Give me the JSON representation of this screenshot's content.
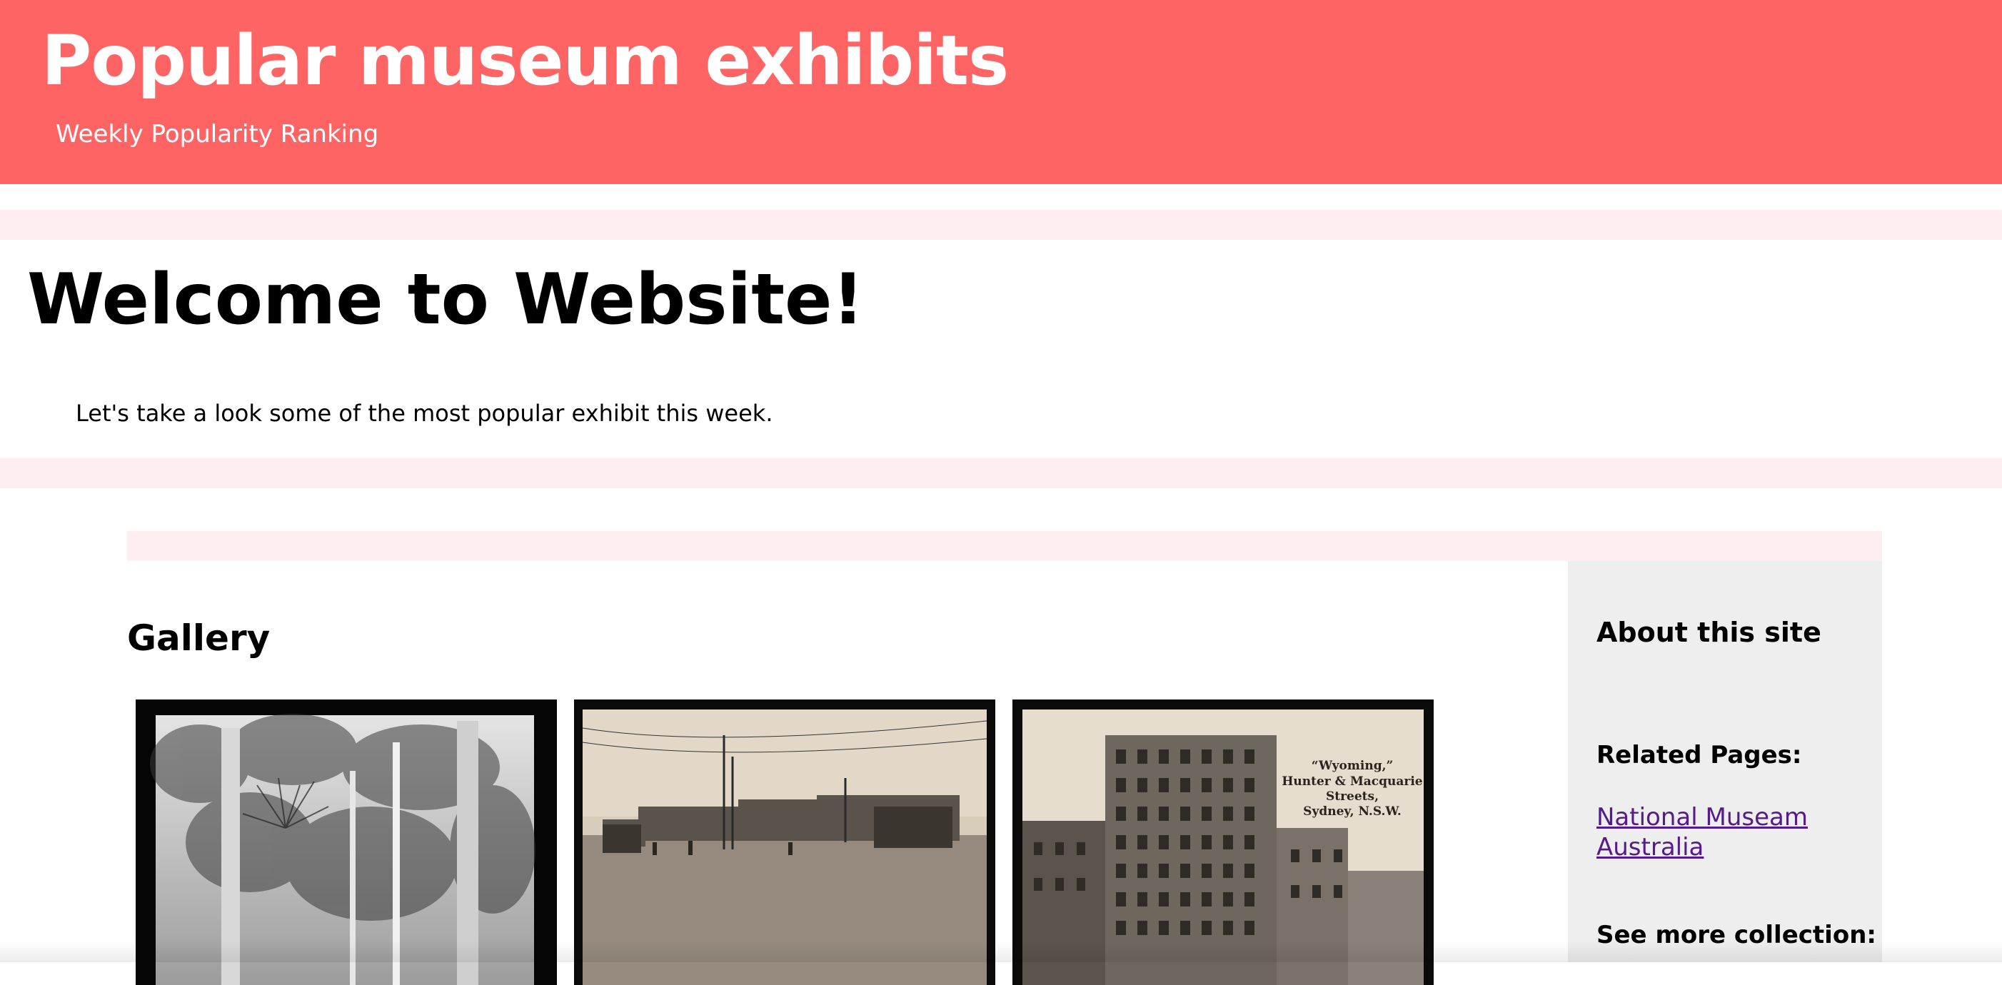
{
  "header": {
    "title": "Popular museum exhibits",
    "subtitle": "Weekly Popularity Ranking",
    "background_color": "#ff6464"
  },
  "welcome": {
    "heading": "Welcome to Website!",
    "text": "Let's take a look some of the most popular exhibit this week."
  },
  "gallery": {
    "heading": "Gallery",
    "items": [
      {
        "image": "rainforest-photo"
      },
      {
        "image": "street-scene-postcard"
      },
      {
        "image": "wyoming-building-postcard",
        "caption_lines": [
          "“Wyoming,”",
          "Hunter & Macquarie",
          "Streets,",
          "Sydney, N.S.W."
        ]
      }
    ]
  },
  "sidebar": {
    "title": "About this site",
    "related_label": "Related Pages:",
    "link_text": "National Museam Australia",
    "more_label": "See more collection:"
  },
  "colors": {
    "accent": "#ff6464",
    "pink_strip": "#ffeef1",
    "sidebar_bg": "#eeeeee",
    "link": "#551a8b"
  }
}
